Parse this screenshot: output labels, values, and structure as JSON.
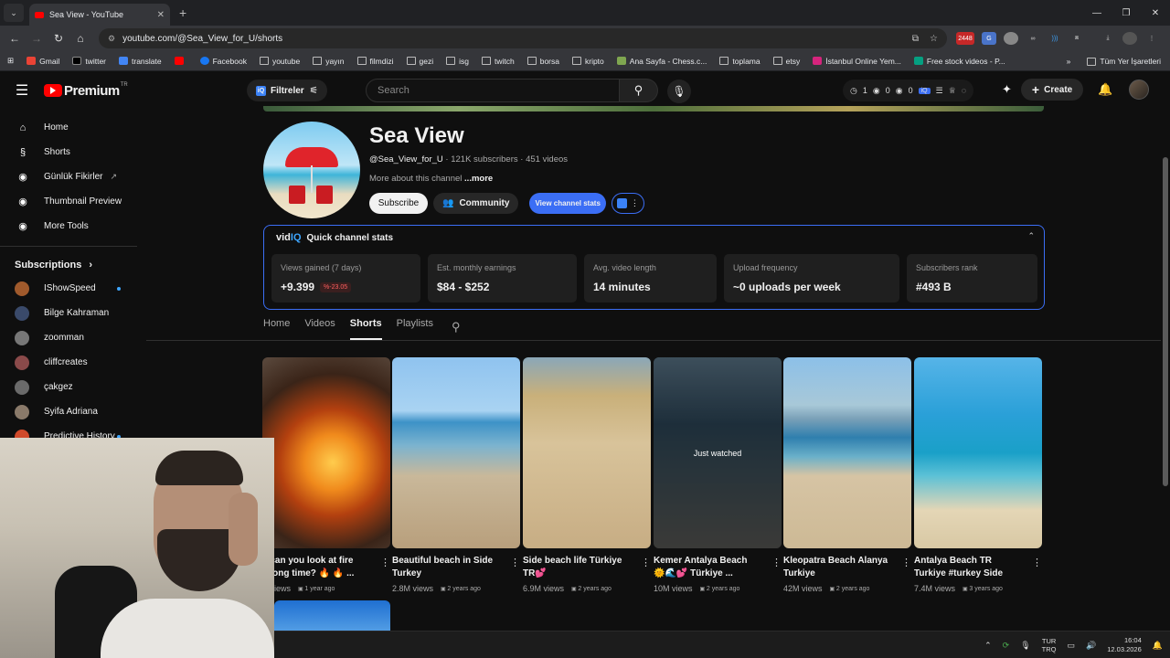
{
  "browser": {
    "tab_title": "Sea View - YouTube",
    "url": "youtube.com/@Sea_View_for_U/shorts",
    "bookmarks": [
      "Gmail",
      "twitter",
      "translate",
      "Facebook",
      "youtube",
      "yayın",
      "filmdizi",
      "gezi",
      "isg",
      "twitch",
      "borsa",
      "kripto",
      "Ana Sayfa - Chess.c...",
      "toplama",
      "etsy",
      "İstanbul Online Yem...",
      "Free stock videos - P..."
    ],
    "all_bookmarks": "Tüm Yer İşaretleri",
    "ext_badge": "2448"
  },
  "header": {
    "brand": "Premium",
    "region": "TR",
    "filter_label": "Filtreler",
    "search_placeholder": "Search",
    "stats": {
      "a": "1",
      "b": "0",
      "c": "0"
    },
    "create_label": "Create"
  },
  "sidebar": {
    "items": [
      {
        "label": "Home",
        "icon": "home-icon"
      },
      {
        "label": "Shorts",
        "icon": "shorts-icon"
      },
      {
        "label": "Günlük Fikirler",
        "icon": "vidiq-icon"
      },
      {
        "label": "Thumbnail Preview",
        "icon": "vidiq-icon"
      },
      {
        "label": "More Tools",
        "icon": "vidiq-icon"
      }
    ],
    "subscriptions_label": "Subscriptions",
    "subscriptions": [
      {
        "name": "IShowSpeed",
        "color": "#a05a2c",
        "live": true
      },
      {
        "name": "Bilge Kahraman",
        "color": "#3a4a6a",
        "live": false
      },
      {
        "name": "zoomman",
        "color": "#777777",
        "live": false
      },
      {
        "name": "cliffcreates",
        "color": "#8a4a4a",
        "live": false
      },
      {
        "name": "çakgez",
        "color": "#6a6a6a",
        "live": false
      },
      {
        "name": "Syifa Adriana",
        "color": "#8a7a6a",
        "live": false
      },
      {
        "name": "Predictive History",
        "color": "#d04a2a",
        "live": true
      }
    ]
  },
  "channel": {
    "name": "Sea View",
    "handle": "@Sea_View_for_U",
    "subscribers": "121K subscribers",
    "videos": "451 videos",
    "about": "More about this channel",
    "more": "...more",
    "subscribe_label": "Subscribe",
    "community_label": "Community",
    "stats_label": "View channel stats"
  },
  "vidiq": {
    "logo_a": "vid",
    "logo_b": "IQ",
    "title": "Quick channel stats",
    "cards": [
      {
        "label": "Views gained (7 days)",
        "value": "+9.399",
        "change": "-23.05"
      },
      {
        "label": "Est. monthly earnings",
        "value": "$84 - $252"
      },
      {
        "label": "Avg. video length",
        "value": "14 minutes"
      },
      {
        "label": "Upload frequency",
        "value": "~0 uploads per week"
      },
      {
        "label": "Subscribers rank",
        "value": "#493 B"
      }
    ]
  },
  "tabs": [
    "Home",
    "Videos",
    "Shorts",
    "Playlists"
  ],
  "active_tab": "Shorts",
  "shorts": [
    {
      "title_1": "y can you look at fire",
      "title_2": "a long time? 🔥 🔥 ...",
      "views": "K views",
      "age": "1 year ago",
      "watched": false
    },
    {
      "title_1": "Beautiful beach in Side",
      "title_2": "Turkey",
      "views": "2.8M views",
      "age": "2 years ago",
      "watched": false
    },
    {
      "title_1": "Side beach life Türkiye",
      "title_2": "TR💕",
      "views": "6.9M views",
      "age": "2 years ago",
      "watched": false
    },
    {
      "title_1": "Kemer Antalya Beach",
      "title_2": "🌞🌊💕 Türkiye ...",
      "views": "10M views",
      "age": "2 years ago",
      "watched": true
    },
    {
      "title_1": "Kleopatra Beach Alanya",
      "title_2": "Turkiye",
      "views": "42M views",
      "age": "2 years ago",
      "watched": false
    },
    {
      "title_1": "Antalya Beach TR",
      "title_2": "Turkiye #turkey Side",
      "views": "7.4M views",
      "age": "3 years ago",
      "watched": false
    }
  ],
  "watched_label": "Just watched",
  "taskbar": {
    "lang_1": "TUR",
    "lang_2": "TRQ",
    "time": "16:04",
    "date": "12.03.2026"
  }
}
